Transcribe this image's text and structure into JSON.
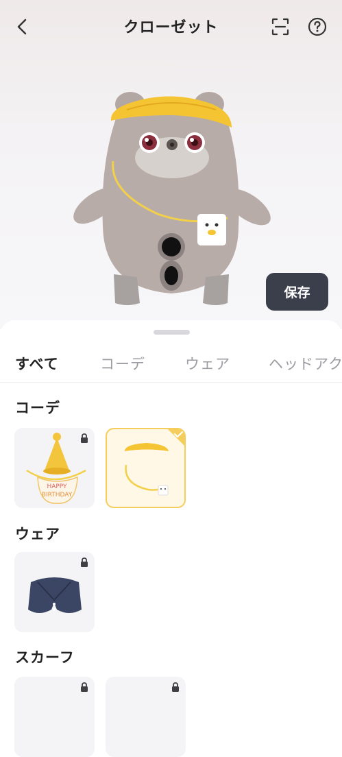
{
  "header": {
    "title": "クローゼット",
    "back_icon": "chevron-left-icon",
    "scan_icon": "scan-icon",
    "help_icon": "help-icon"
  },
  "preview": {
    "save_label": "保存"
  },
  "tabs": [
    {
      "label": "すべて",
      "active": true
    },
    {
      "label": "コーデ",
      "active": false
    },
    {
      "label": "ウェア",
      "active": false
    },
    {
      "label": "ヘッドアクセ",
      "active": false
    }
  ],
  "sections": [
    {
      "title": "コーデ",
      "items": [
        {
          "name": "birthday-set",
          "locked": true,
          "selected": false,
          "bib_text": "HAPPY BIRTHDAY"
        },
        {
          "name": "yellow-hat-set",
          "locked": false,
          "selected": true
        }
      ]
    },
    {
      "title": "ウェア",
      "items": [
        {
          "name": "navy-vest",
          "locked": true,
          "selected": false
        }
      ]
    },
    {
      "title": "スカーフ",
      "items": [
        {
          "name": "scarf-1",
          "locked": true,
          "selected": false
        },
        {
          "name": "scarf-2",
          "locked": true,
          "selected": false
        }
      ]
    }
  ],
  "colors": {
    "accent_yellow": "#f5cd5b",
    "save_button": "#3a3f4b",
    "robot_body": "#b8aca9"
  }
}
